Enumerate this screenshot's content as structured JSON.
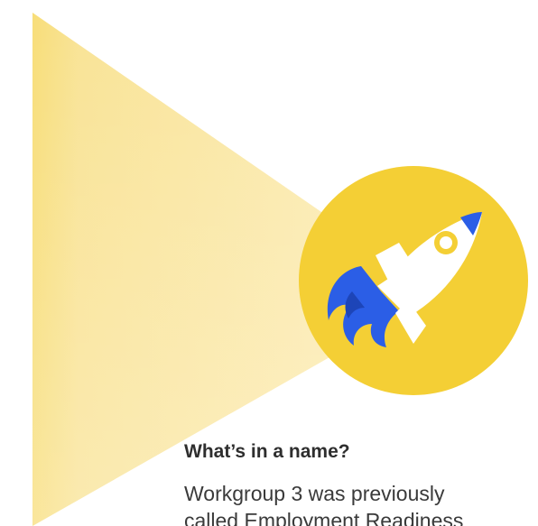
{
  "colors": {
    "beam_start": "#f6d55c",
    "beam_end": "#fdf1c8",
    "badge": "#f4cf35",
    "rocket_body": "#ffffff",
    "rocket_accent": "#2b5ee6",
    "heading_text": "#2e2e2e",
    "body_text": "#3a3a3a"
  },
  "badge": {
    "icon": "rocket-icon"
  },
  "section": {
    "heading": "What’s in a name?",
    "body_line1": "Workgroup 3 was previously",
    "body_line2": "called Employment Readiness"
  }
}
